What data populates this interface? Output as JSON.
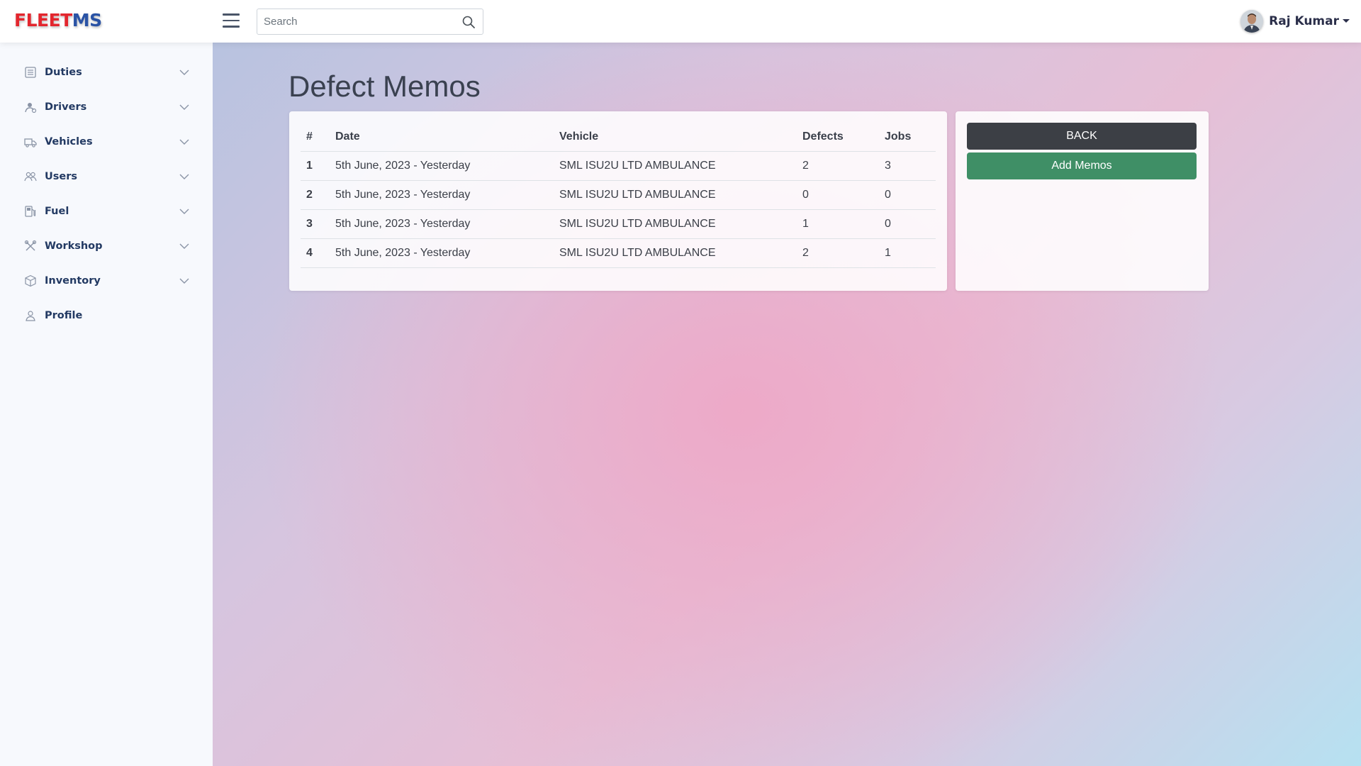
{
  "brand": {
    "part1": "FLEET",
    "part2": "MS"
  },
  "search": {
    "placeholder": "Search"
  },
  "user": {
    "name": "Raj Kumar"
  },
  "sidebar": {
    "items": [
      {
        "label": "Duties",
        "icon": "list-icon",
        "expandable": true
      },
      {
        "label": "Drivers",
        "icon": "driver-icon",
        "expandable": true
      },
      {
        "label": "Vehicles",
        "icon": "truck-icon",
        "expandable": true
      },
      {
        "label": "Users",
        "icon": "users-icon",
        "expandable": true
      },
      {
        "label": "Fuel",
        "icon": "fuel-pump-icon",
        "expandable": true
      },
      {
        "label": "Workshop",
        "icon": "tools-icon",
        "expandable": true
      },
      {
        "label": "Inventory",
        "icon": "box-icon",
        "expandable": true
      },
      {
        "label": "Profile",
        "icon": "person-icon",
        "expandable": false
      }
    ]
  },
  "page": {
    "title": "Defect Memos"
  },
  "table": {
    "columns": [
      "#",
      "Date",
      "Vehicle",
      "Defects",
      "Jobs"
    ],
    "rows": [
      {
        "num": "1",
        "date": "5th June, 2023 - Yesterday",
        "vehicle": "SML ISU2U LTD AMBULANCE",
        "defects": "2",
        "jobs": "3"
      },
      {
        "num": "2",
        "date": "5th June, 2023 - Yesterday",
        "vehicle": "SML ISU2U LTD AMBULANCE",
        "defects": "0",
        "jobs": "0"
      },
      {
        "num": "3",
        "date": "5th June, 2023 - Yesterday",
        "vehicle": "SML ISU2U LTD AMBULANCE",
        "defects": "1",
        "jobs": "0"
      },
      {
        "num": "4",
        "date": "5th June, 2023 - Yesterday",
        "vehicle": "SML ISU2U LTD AMBULANCE",
        "defects": "2",
        "jobs": "1"
      }
    ]
  },
  "actions": {
    "back_label": "BACK",
    "add_label": "Add Memos"
  },
  "colors": {
    "brand_red": "#e3262e",
    "brand_blue": "#2a53a5",
    "back_button": "#3c3f45",
    "add_button": "#3f8f66",
    "nav_text": "#233a63"
  }
}
